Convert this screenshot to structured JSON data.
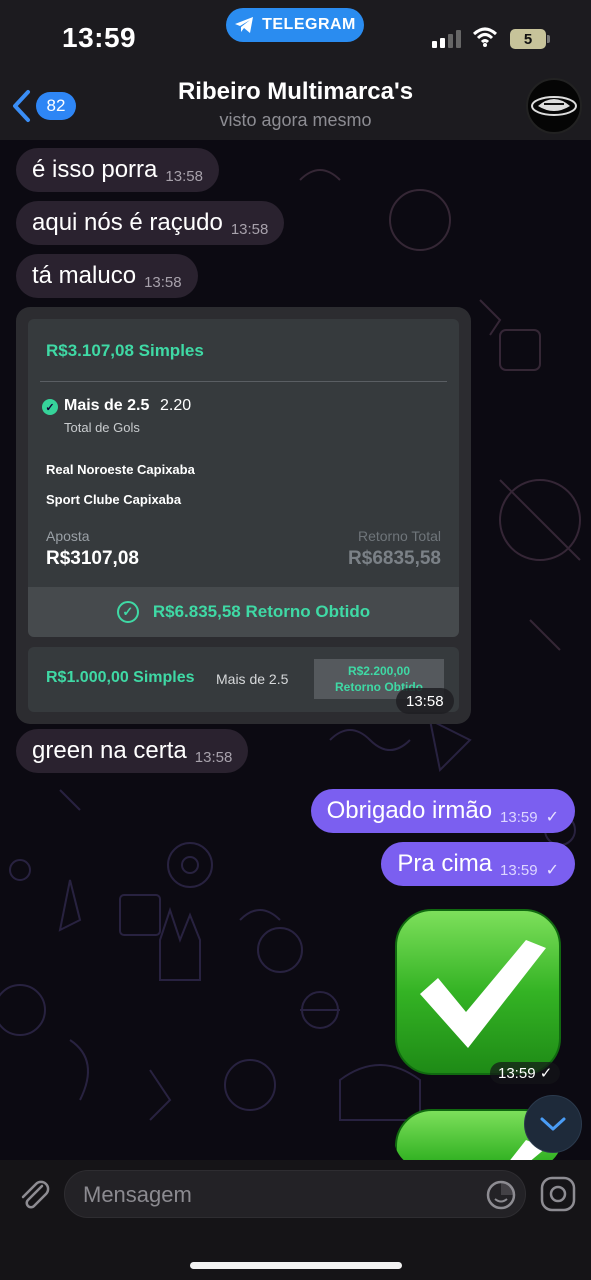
{
  "status_bar": {
    "time": "13:59",
    "app_pill": "TELEGRAM",
    "battery": "5"
  },
  "header": {
    "back_count": "82",
    "title": "Ribeiro Multimarca's",
    "subtitle": "visto agora mesmo"
  },
  "messages": [
    {
      "text": "é isso porra",
      "time": "13:58",
      "dir": "in"
    },
    {
      "text": "aqui nós é raçudo",
      "time": "13:58",
      "dir": "in"
    },
    {
      "text": "tá maluco",
      "time": "13:58",
      "dir": "in"
    },
    {
      "text": "green na certa",
      "time": "13:58",
      "dir": "in"
    },
    {
      "text": "Obrigado irmão",
      "time": "13:59",
      "dir": "out"
    },
    {
      "text": "Pra cima",
      "time": "13:59",
      "dir": "out"
    }
  ],
  "bet_card": {
    "title": "R$3.107,08 Simples",
    "selection": "Mais de 2.5",
    "odd": "2.20",
    "market": "Total de Gols",
    "team_home": "Real Noroeste Capixaba",
    "team_away": "Sport Clube Capixaba",
    "stake_label": "Aposta",
    "stake_value": "R$3107,08",
    "return_label": "Retorno Total",
    "return_value": "R$6835,58",
    "result": "R$6.835,58 Retorno Obtido",
    "second_title": "R$1.000,00 Simples",
    "second_market": "Mais de 2.5",
    "second_return_line1": "R$2.200,00",
    "second_return_line2": "Retorno Obtido",
    "time": "13:58"
  },
  "sticker": {
    "time": "13:59"
  },
  "input": {
    "placeholder": "Mensagem"
  },
  "colors": {
    "outgoing_bubble": "#7b5ff0",
    "incoming_bubble": "#2a222f",
    "accent_blue": "#2e86f5",
    "bet_green": "#3fd9a5",
    "check_green": "#2fae2c"
  },
  "icons": [
    "telegram-icon",
    "signal-icon",
    "wifi-icon",
    "back-chevron-icon",
    "paperclip-icon",
    "sticker-icon",
    "camera-icon",
    "chevron-down-icon",
    "check-mark-icon"
  ]
}
